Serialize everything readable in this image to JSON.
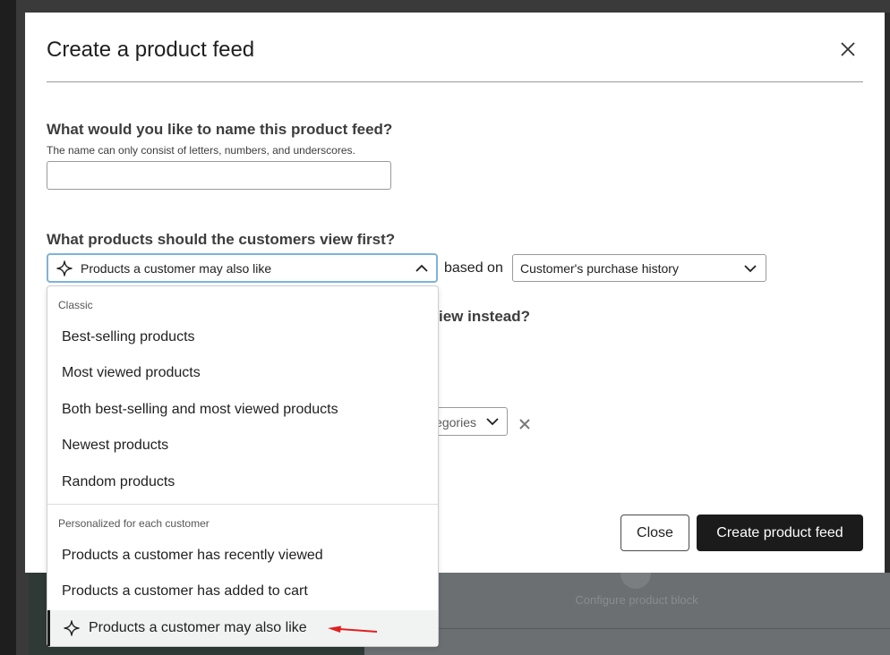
{
  "modal": {
    "title": "Create a product feed",
    "name_question": "What would you like to name this product feed?",
    "name_help": "The name can only consist of letters, numbers, and underscores.",
    "name_value": "",
    "products_question": "What products should the customers view first?",
    "products_selected": "Products a customer may also like",
    "based_on_label": "based on",
    "basis_selected": "Customer's purchase history",
    "partial_question": "iew instead?",
    "category_partial": "egories",
    "close_button": "Close",
    "create_button": "Create product feed"
  },
  "dropdown": {
    "groups": [
      {
        "label": "Classic",
        "options": [
          "Best-selling products",
          "Most viewed products",
          "Both best-selling and most viewed products",
          "Newest products",
          "Random products"
        ]
      },
      {
        "label": "Personalized for each customer",
        "options": [
          "Products a customer has recently viewed",
          "Products a customer has added to cart",
          "Products a customer may also like"
        ]
      }
    ]
  },
  "background": {
    "block_label": "Configure product block"
  },
  "colors": {
    "primary_button": "#1b1b1b",
    "focus_border": "#7fb3d5",
    "annotation_arrow": "#e02020"
  },
  "icons": {
    "sparkle": "sparkle-icon",
    "close": "close-icon",
    "chevron_up": "chevron-up-icon",
    "chevron_down": "chevron-down-icon",
    "remove": "remove-icon"
  }
}
